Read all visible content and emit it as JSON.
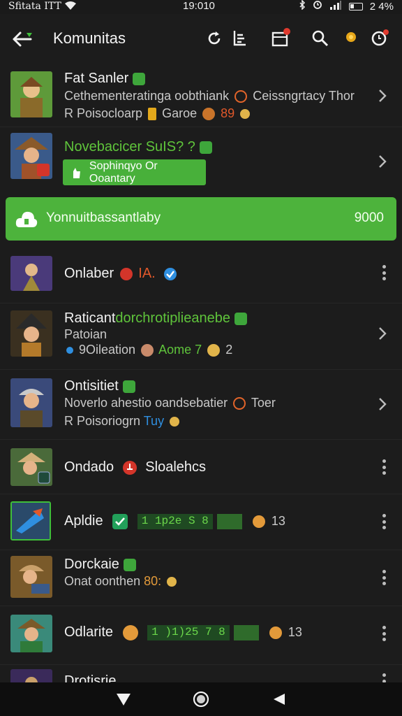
{
  "status_bar": {
    "carrier": "Sfitata ITT",
    "time": "19:010",
    "battery": "2 4%"
  },
  "app_bar": {
    "title": "Komunitas"
  },
  "rows": [
    {
      "title": "Fat Sanler",
      "line1": "Cethementeratinga oobthiank",
      "line1_tail": "Ceissngrtacy Thor",
      "line2a": "R Poisocloarp",
      "line2b": "Garoe",
      "line2c": "89"
    },
    {
      "title": "Novebacicer SuIS? ?",
      "button": "Sophinqyo Or Ooantary"
    },
    {
      "title": "Onlaber",
      "tag": "IA."
    },
    {
      "title_a": "Raticant",
      "title_b": "dorchrotiplieanebe",
      "line1": "Patoian",
      "line2a": "9Oileation",
      "line2b": "Aome 7",
      "line2c": "2"
    },
    {
      "title": "Ontisitiet",
      "line1": "Noverlo ahestio oandsebatier",
      "line1_tail": "Toer",
      "line2a": "R Poisoriogrn",
      "line2b": "Tuy"
    },
    {
      "title": "Ondado",
      "tag": "Sloalehcs"
    },
    {
      "title": "Apldie",
      "score": "1 1p2e S 8",
      "tail": "13"
    },
    {
      "title": "Dorckaie",
      "line1": "Onat oonthen",
      "line1_num": "80:"
    },
    {
      "title": "Odlarite",
      "score": "1 )1)25 7 8",
      "tail": "13"
    },
    {
      "title": "Drotisrie"
    }
  ],
  "banner": {
    "text": "Yonnuitbassantlaby",
    "value": "9000"
  },
  "colors": {
    "accent": "#4db33c",
    "background": "#1c1c1c",
    "divider": "#262626"
  },
  "icons": [
    "back-arrow-icon",
    "refresh-icon",
    "list-icon",
    "inbox-icon",
    "search-icon",
    "coin-icon",
    "timer-icon",
    "chevron-right-icon",
    "kebab-icon"
  ]
}
